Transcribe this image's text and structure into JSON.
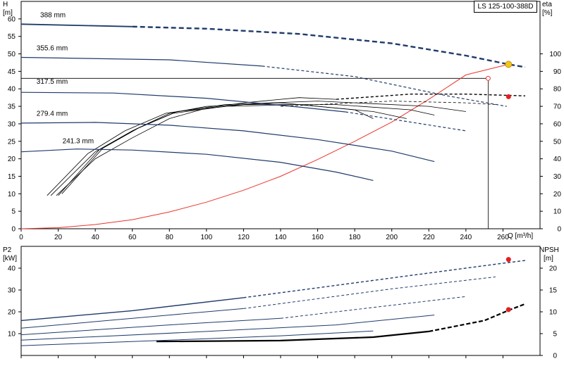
{
  "title_box": "LS 125-100-388D",
  "colors": {
    "curve": "#1f3b6b",
    "efficiency": "#000000",
    "system": "#e8352b",
    "grid": "#000000",
    "operating_point": "#f5c518",
    "marker_red": "#e51e1e"
  },
  "chart_data": [
    {
      "type": "line",
      "panel": "head-efficiency",
      "xlabel": "Q [m³/h]",
      "ylabel_left": "H",
      "ylabel_left_unit": "[m]",
      "ylabel_right": "eta",
      "ylabel_right_unit": "[%]",
      "xlim": [
        0,
        280
      ],
      "ylim_left": [
        0,
        65
      ],
      "ylim_right": [
        0,
        130
      ],
      "x_ticks": [
        "0",
        "20",
        "40",
        "60",
        "80",
        "100",
        "120",
        "140",
        "160",
        "180",
        "200",
        "220",
        "240",
        "260"
      ],
      "y_ticks_left": [
        "0",
        "5",
        "10",
        "15",
        "20",
        "25",
        "30",
        "35",
        "40",
        "45",
        "50",
        "55",
        "60"
      ],
      "y_ticks_right": [
        "0",
        "10",
        "20",
        "30",
        "40",
        "50",
        "60",
        "70",
        "80",
        "90",
        "100"
      ],
      "impeller_labels": [
        "388 mm",
        "355.6 mm",
        "317.5 mm",
        "279.4 mm",
        "241.3 mm"
      ],
      "head_curves": [
        {
          "name": "388 mm",
          "solid": [
            [
              0,
              58.5
            ],
            [
              60,
              57.8
            ]
          ],
          "dashed": [
            [
              60,
              57.8
            ],
            [
              100,
              57.2
            ],
            [
              150,
              55.7
            ],
            [
              200,
              53.0
            ],
            [
              240,
              49.5
            ],
            [
              263,
              47.0
            ],
            [
              272,
              46.2
            ]
          ]
        },
        {
          "name": "355.6 mm",
          "solid": [
            [
              0,
              49
            ],
            [
              80,
              48.3
            ],
            [
              130,
              46.5
            ]
          ],
          "dashed": [
            [
              130,
              46.5
            ],
            [
              180,
              43.5
            ],
            [
              230,
              38.0
            ],
            [
              262,
              35.0
            ]
          ]
        },
        {
          "name": "317.5 mm",
          "solid": [
            [
              0,
              39
            ],
            [
              50,
              38.8
            ],
            [
              100,
              37.3
            ],
            [
              150,
              34.8
            ],
            [
              175,
              33.4
            ]
          ],
          "dashed": [
            [
              175,
              33.4
            ],
            [
              210,
              30.5
            ],
            [
              240,
              28.0
            ]
          ]
        },
        {
          "name": "279.4 mm",
          "solid": [
            [
              0,
              30.2
            ],
            [
              40,
              30.4
            ],
            [
              80,
              29.6
            ],
            [
              120,
              28
            ],
            [
              160,
              25.5
            ],
            [
              200,
              22.2
            ],
            [
              223,
              19.2
            ]
          ],
          "dashed": []
        },
        {
          "name": "241.3 mm",
          "solid": [
            [
              0,
              22
            ],
            [
              30,
              22.8
            ],
            [
              60,
              22.5
            ],
            [
              100,
              21.3
            ],
            [
              140,
              19.0
            ],
            [
              170,
              16.2
            ],
            [
              190,
              13.8
            ]
          ],
          "dashed": []
        }
      ],
      "efficiency_curves": [
        {
          "solid": [
            [
              19,
              19
            ],
            [
              40,
              40
            ],
            [
              60,
              52
            ],
            [
              80,
              63
            ],
            [
              100,
              69
            ],
            [
              120,
              72
            ],
            [
              150,
              75
            ],
            [
              170,
              74
            ]
          ],
          "dashed": [
            [
              170,
              74
            ],
            [
              210,
              77
            ],
            [
              240,
              77
            ],
            [
              272,
              76
            ]
          ]
        },
        {
          "solid": [
            [
              16,
              19
            ],
            [
              40,
              44
            ],
            [
              60,
              56
            ],
            [
              80,
              66
            ],
            [
              100,
              70
            ],
            [
              140,
              72
            ],
            [
              180,
              68
            ],
            [
              190,
              63
            ]
          ],
          "dashed": []
        },
        {
          "solid": [
            [
              20,
              19
            ],
            [
              42,
              45
            ],
            [
              62,
              57
            ],
            [
              82,
              66
            ],
            [
              110,
              70
            ],
            [
              150,
              71
            ],
            [
              190,
              67
            ],
            [
              208,
              63
            ]
          ],
          "dashed": []
        },
        {
          "solid": [
            [
              22,
              20
            ],
            [
              44,
              46
            ],
            [
              64,
              58
            ],
            [
              84,
              67
            ],
            [
              120,
              71
            ],
            [
              170,
              71
            ],
            [
              210,
              68
            ],
            [
              223,
              65
            ]
          ],
          "dashed": []
        },
        {
          "solid": [
            [
              14,
              19
            ],
            [
              36,
              43
            ],
            [
              56,
              56
            ],
            [
              78,
              66
            ],
            [
              110,
              71
            ],
            [
              160,
              73
            ],
            [
              220,
              70
            ],
            [
              240,
              67
            ]
          ],
          "dashed": []
        },
        {
          "solid": [],
          "dashed": [
            [
              140,
              70
            ],
            [
              200,
              73
            ],
            [
              240,
              72
            ],
            [
              257,
              71
            ]
          ]
        }
      ],
      "system_curve": [
        [
          0,
          0
        ],
        [
          20,
          0.3
        ],
        [
          40,
          1.2
        ],
        [
          60,
          2.6
        ],
        [
          80,
          4.8
        ],
        [
          100,
          7.6
        ],
        [
          120,
          11
        ],
        [
          140,
          15
        ],
        [
          160,
          19.8
        ],
        [
          180,
          25
        ],
        [
          200,
          30.5
        ],
        [
          220,
          37
        ],
        [
          240,
          44
        ],
        [
          263,
          47
        ]
      ],
      "operating_point": {
        "q": 263,
        "h": 47,
        "eta": 75.5
      },
      "reference_point": {
        "q": 252,
        "h": 43
      },
      "ref_line_h": 43,
      "ref_line_q": 252
    },
    {
      "type": "line",
      "panel": "power-npsh",
      "xlabel": "",
      "ylabel_left": "P2",
      "ylabel_left_unit": "[kW]",
      "ylabel_right": "NPSH",
      "ylabel_right_unit": "[m]",
      "xlim": [
        0,
        280
      ],
      "ylim_left": [
        0,
        50
      ],
      "ylim_right": [
        0,
        25
      ],
      "y_ticks_left": [
        "10",
        "20",
        "30",
        "40"
      ],
      "y_ticks_right": [
        "0",
        "5",
        "10",
        "15",
        "20"
      ],
      "power_curves": [
        {
          "solid": [
            [
              0,
              16
            ],
            [
              60,
              20.5
            ],
            [
              120,
              26.5
            ]
          ],
          "dashed": [
            [
              120,
              26.5
            ],
            [
              200,
              35.5
            ],
            [
              262,
              42.5
            ],
            [
              272,
              43.5
            ]
          ]
        },
        {
          "solid": [
            [
              0,
              12.5
            ],
            [
              80,
              18.5
            ],
            [
              120,
              21.5
            ]
          ],
          "dashed": [
            [
              120,
              21.5
            ],
            [
              200,
              30.5
            ],
            [
              256,
              36
            ]
          ]
        },
        {
          "solid": [
            [
              0,
              9.5
            ],
            [
              80,
              14
            ],
            [
              140,
              17
            ]
          ],
          "dashed": [
            [
              140,
              17
            ],
            [
              240,
              27
            ]
          ]
        },
        {
          "solid": [
            [
              0,
              7
            ],
            [
              100,
              11
            ],
            [
              170,
              14
            ],
            [
              223,
              18.5
            ]
          ],
          "dashed": []
        },
        {
          "solid": [
            [
              0,
              4.5
            ],
            [
              80,
              7
            ],
            [
              140,
              9
            ],
            [
              190,
              11.2
            ]
          ],
          "dashed": []
        }
      ],
      "npsh_curve": {
        "solid": [
          [
            73,
            3.2
          ],
          [
            140,
            3.4
          ],
          [
            190,
            4.2
          ],
          [
            220,
            5.5
          ]
        ],
        "dashed": [
          [
            220,
            5.5
          ],
          [
            250,
            8
          ],
          [
            264,
            10.5
          ],
          [
            272,
            11.8
          ]
        ]
      },
      "power_point": {
        "q": 263,
        "p": 44
      },
      "npsh_point": {
        "q": 263,
        "npsh": 10.5
      }
    }
  ]
}
